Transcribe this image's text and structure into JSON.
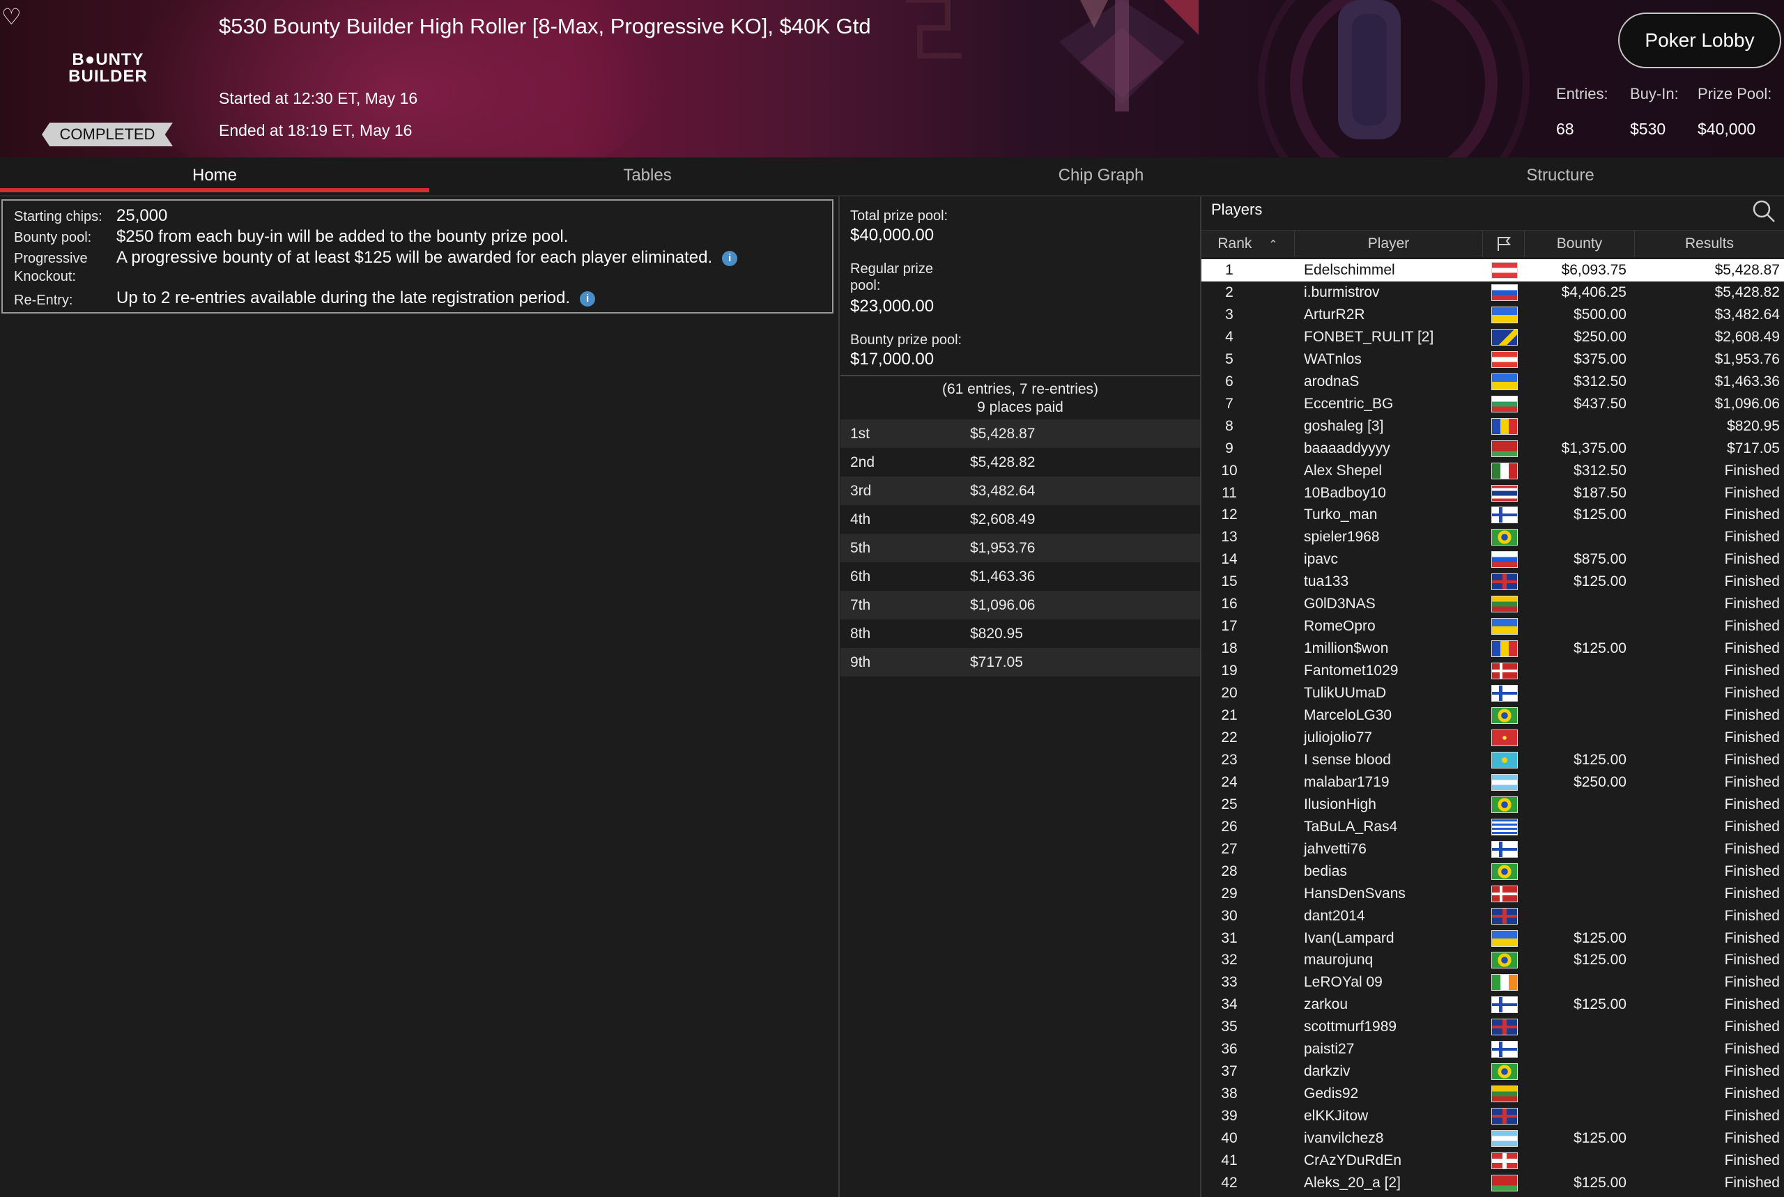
{
  "header": {
    "title": "$530 Bounty Builder High Roller [8-Max, Progressive KO], $40K Gtd",
    "logo_top": "B●UNTY",
    "logo_bottom": "BUILDER",
    "status": "COMPLETED",
    "started": "Started at 12:30 ET, May 16",
    "ended": "Ended at 18:19 ET, May 16",
    "lobby_button": "Poker Lobby",
    "stats": {
      "entries_label": "Entries:",
      "entries_value": "68",
      "buyin_label": "Buy-In:",
      "buyin_value": "$530",
      "pool_label": "Prize Pool:",
      "pool_value": "$40,000"
    },
    "accent": "#d32f2f"
  },
  "tabs": [
    "Home",
    "Tables",
    "Chip Graph",
    "Structure"
  ],
  "info": {
    "starting_label": "Starting chips:",
    "starting_value": "25,000",
    "bounty_label": "Bounty pool:",
    "bounty_value": "$250 from each buy-in will be added to the bounty prize pool.",
    "pko_label_1": "Progressive",
    "pko_label_2": "Knockout:",
    "pko_value": "A progressive bounty of at least $125 will be awarded for each player eliminated.",
    "reentry_label": "Re-Entry:",
    "reentry_value": "Up to 2 re-entries available during the late registration period.",
    "info_icon": "i"
  },
  "prize": {
    "total_label": "Total prize pool:",
    "total_value": "$40,000.00",
    "regular_label_1": "Regular prize",
    "regular_label_2": "pool:",
    "regular_value": "$23,000.00",
    "bounty_label": "Bounty prize pool:",
    "bounty_value": "$17,000.00",
    "summary_1": "(61 entries, 7 re-entries)",
    "summary_2": "9 places paid",
    "payouts": [
      {
        "place": "1st",
        "amount": "$5,428.87"
      },
      {
        "place": "2nd",
        "amount": "$5,428.82"
      },
      {
        "place": "3rd",
        "amount": "$3,482.64"
      },
      {
        "place": "4th",
        "amount": "$2,608.49"
      },
      {
        "place": "5th",
        "amount": "$1,953.76"
      },
      {
        "place": "6th",
        "amount": "$1,463.36"
      },
      {
        "place": "7th",
        "amount": "$1,096.06"
      },
      {
        "place": "8th",
        "amount": "$820.95"
      },
      {
        "place": "9th",
        "amount": "$717.05"
      }
    ]
  },
  "players": {
    "title": "Players",
    "columns": {
      "rank": "Rank",
      "player": "Player",
      "bounty": "Bounty",
      "results": "Results"
    },
    "rows": [
      {
        "rank": "1",
        "name": "Edelschimmel",
        "flag": "austria",
        "bounty": "$6,093.75",
        "result": "$5,428.87"
      },
      {
        "rank": "2",
        "name": "i.burmistrov",
        "flag": "russia",
        "bounty": "$4,406.25",
        "result": "$5,428.82"
      },
      {
        "rank": "3",
        "name": "ArturR2R",
        "flag": "ukraine",
        "bounty": "$500.00",
        "result": "$3,482.64"
      },
      {
        "rank": "4",
        "name": "FONBET_RULIT [2]",
        "flag": "bosnia",
        "bounty": "$250.00",
        "result": "$2,608.49"
      },
      {
        "rank": "5",
        "name": "WATnlos",
        "flag": "austria",
        "bounty": "$375.00",
        "result": "$1,953.76"
      },
      {
        "rank": "6",
        "name": "arodnaS",
        "flag": "ukraine",
        "bounty": "$312.50",
        "result": "$1,463.36"
      },
      {
        "rank": "7",
        "name": "Eccentric_BG",
        "flag": "bulgaria",
        "bounty": "$437.50",
        "result": "$1,096.06"
      },
      {
        "rank": "8",
        "name": "goshaleg [3]",
        "flag": "romania",
        "bounty": "",
        "result": "$820.95"
      },
      {
        "rank": "9",
        "name": "baaaaddyyyy",
        "flag": "belarus",
        "bounty": "$1,375.00",
        "result": "$717.05"
      },
      {
        "rank": "10",
        "name": "Alex Shepel",
        "flag": "mexico",
        "bounty": "$312.50",
        "result": "Finished"
      },
      {
        "rank": "11",
        "name": "10Badboy10",
        "flag": "thailand",
        "bounty": "$187.50",
        "result": "Finished"
      },
      {
        "rank": "12",
        "name": "Turko_man",
        "flag": "finland",
        "bounty": "$125.00",
        "result": "Finished"
      },
      {
        "rank": "13",
        "name": "spieler1968",
        "flag": "brazil",
        "bounty": "",
        "result": "Finished"
      },
      {
        "rank": "14",
        "name": "ipavc",
        "flag": "slovenia",
        "bounty": "$875.00",
        "result": "Finished"
      },
      {
        "rank": "15",
        "name": "tua133",
        "flag": "uk",
        "bounty": "$125.00",
        "result": "Finished"
      },
      {
        "rank": "16",
        "name": "G0lD3NAS",
        "flag": "lithuania",
        "bounty": "",
        "result": "Finished"
      },
      {
        "rank": "17",
        "name": "RomeOpro",
        "flag": "ukraine",
        "bounty": "",
        "result": "Finished"
      },
      {
        "rank": "18",
        "name": "1million$won",
        "flag": "romania",
        "bounty": "$125.00",
        "result": "Finished"
      },
      {
        "rank": "19",
        "name": "Fantomet1029",
        "flag": "denmark",
        "bounty": "",
        "result": "Finished"
      },
      {
        "rank": "20",
        "name": "TulikUUmaD",
        "flag": "finland",
        "bounty": "",
        "result": "Finished"
      },
      {
        "rank": "21",
        "name": "MarceloLG30",
        "flag": "brazil",
        "bounty": "",
        "result": "Finished"
      },
      {
        "rank": "22",
        "name": "juliojolio77",
        "flag": "isle-of-man",
        "bounty": "",
        "result": "Finished"
      },
      {
        "rank": "23",
        "name": "I sense blood",
        "flag": "kazakhstan",
        "bounty": "$125.00",
        "result": "Finished"
      },
      {
        "rank": "24",
        "name": "malabar1719",
        "flag": "argentina",
        "bounty": "$250.00",
        "result": "Finished"
      },
      {
        "rank": "25",
        "name": "IlusionHigh",
        "flag": "brazil",
        "bounty": "",
        "result": "Finished"
      },
      {
        "rank": "26",
        "name": "TaBuLA_Ras4",
        "flag": "greece",
        "bounty": "",
        "result": "Finished"
      },
      {
        "rank": "27",
        "name": "jahvetti76",
        "flag": "finland",
        "bounty": "",
        "result": "Finished"
      },
      {
        "rank": "28",
        "name": "bedias",
        "flag": "brazil",
        "bounty": "",
        "result": "Finished"
      },
      {
        "rank": "29",
        "name": "HansDenSvans",
        "flag": "denmark",
        "bounty": "",
        "result": "Finished"
      },
      {
        "rank": "30",
        "name": "dant2014",
        "flag": "uk",
        "bounty": "",
        "result": "Finished"
      },
      {
        "rank": "31",
        "name": "Ivan(Lampard",
        "flag": "ukraine",
        "bounty": "$125.00",
        "result": "Finished"
      },
      {
        "rank": "32",
        "name": "maurojunq",
        "flag": "brazil",
        "bounty": "$125.00",
        "result": "Finished"
      },
      {
        "rank": "33",
        "name": "LeROYal 09",
        "flag": "ireland",
        "bounty": "",
        "result": "Finished"
      },
      {
        "rank": "34",
        "name": "zarkou",
        "flag": "finland",
        "bounty": "$125.00",
        "result": "Finished"
      },
      {
        "rank": "35",
        "name": "scottmurf1989",
        "flag": "uk",
        "bounty": "",
        "result": "Finished"
      },
      {
        "rank": "36",
        "name": "paisti27",
        "flag": "finland",
        "bounty": "",
        "result": "Finished"
      },
      {
        "rank": "37",
        "name": "darkziv",
        "flag": "brazil",
        "bounty": "",
        "result": "Finished"
      },
      {
        "rank": "38",
        "name": "Gedis92",
        "flag": "lithuania",
        "bounty": "",
        "result": "Finished"
      },
      {
        "rank": "39",
        "name": "elKKJitow",
        "flag": "uk",
        "bounty": "",
        "result": "Finished"
      },
      {
        "rank": "40",
        "name": "ivanvilchez8",
        "flag": "argentina",
        "bounty": "$125.00",
        "result": "Finished"
      },
      {
        "rank": "41",
        "name": "CrAzYDuRdEn",
        "flag": "switzerland",
        "bounty": "",
        "result": "Finished"
      },
      {
        "rank": "42",
        "name": "Aleks_20_a [2]",
        "flag": "belarus",
        "bounty": "$125.00",
        "result": "Finished"
      }
    ]
  }
}
